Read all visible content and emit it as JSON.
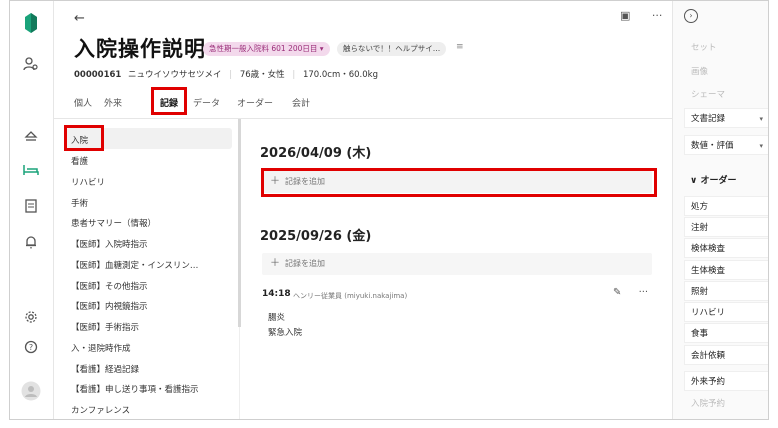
{
  "header": {
    "back_icon": "arrow-left-icon",
    "title": "入院操作説明",
    "badge_admission": "急性期一般入院料 601 200日目 ▾",
    "badge_note": "触らないで！！ヘルプサイ…",
    "patient_id": "00000161",
    "patient_kana": "ニュウイソウサセツメイ",
    "age_sex": "76歳・女性",
    "body": "170.0cm・60.0kg",
    "top_icons": [
      "id-card-icon",
      "more-horizontal-icon"
    ]
  },
  "tabs": [
    {
      "label": "個人"
    },
    {
      "label": "外来"
    },
    {
      "label": "記録",
      "active": true
    },
    {
      "label": "データ"
    },
    {
      "label": "オーダー"
    },
    {
      "label": "会計"
    }
  ],
  "categories": [
    "入院",
    "看護",
    "リハビリ",
    "手術",
    "患者サマリー（情報）",
    "【医師】入院時指示",
    "【医師】血糖測定・インスリン…",
    "【医師】その他指示",
    "【医師】内視鏡指示",
    "【医師】手術指示",
    "入・退院時作成",
    "【看護】経過記録",
    "【看護】申し送り事項・看護指示",
    "カンファレンス"
  ],
  "records": {
    "add_label": "記録を追加",
    "groups": [
      {
        "date": "2026/04/09 (木)"
      },
      {
        "date": "2025/09/26 (金)"
      }
    ],
    "entry": {
      "time": "14:18",
      "author": "ヘンリー従業員 (miyuki.nakajima)",
      "lines": [
        "腸炎",
        "緊急入院"
      ]
    }
  },
  "right_panel": {
    "top_icon": "chevron-right-circle-icon",
    "dim_items": [
      "セット",
      "画像",
      "シェーマ"
    ],
    "dropdowns": [
      "文書記録",
      "数値・評価"
    ],
    "order_section": "∨ オーダー",
    "order_items": [
      "処方",
      "注射",
      "検体検査",
      "生体検査",
      "照射",
      "リハビリ",
      "食事",
      "会計依頼"
    ],
    "reservations": [
      "外来予約",
      "入院予約"
    ]
  },
  "colors": {
    "accent": "#1aa37a",
    "highlight": "#e00000",
    "badge_pink": "#f3d9ec"
  }
}
